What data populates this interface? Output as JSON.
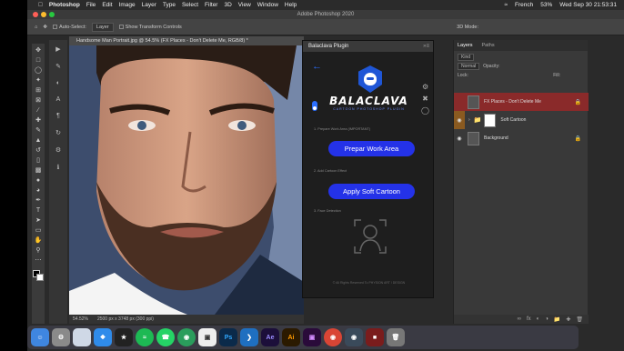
{
  "menubar": {
    "app": "Photoshop",
    "items": [
      "File",
      "Edit",
      "Image",
      "Layer",
      "Type",
      "Select",
      "Filter",
      "3D",
      "View",
      "Window",
      "Help"
    ],
    "language": "French",
    "battery": "53%",
    "datetime": "Wed Sep 30  21:53:31"
  },
  "window": {
    "title": "Adobe Photoshop 2020"
  },
  "options": {
    "auto_select_label": "Auto-Select:",
    "auto_select_value": "Layer",
    "show_transform": "Show Transform Controls",
    "mode_3d": "3D Mode:"
  },
  "document": {
    "tab_title": "Handsome Man Portrait.jpg @ 54.5% (FX Places - Don't Delete Me, RGB/8) *",
    "zoom": "54.52%",
    "dimensions": "2500 px x 3748 px (300 ppi)"
  },
  "plugin": {
    "title": "Balaclava Plugin",
    "brand": "BALACLAVA",
    "tagline": "CARTOON PHOTOSHOP PLUGIN",
    "step1": "1. Prepare Work Area (IMPORTANT)",
    "step2": "2. Add Cartoon Effect",
    "step3": "3. Face Detection",
    "btn_prepare": "Prepar Work Area",
    "btn_apply": "Apply Soft Cartoon",
    "footer": "© All Rights Reserved To PHYSION ART / DESIGN"
  },
  "layers_panel": {
    "tabs": [
      "Layers",
      "Paths"
    ],
    "filter": "Kind",
    "blend_mode": "Normal",
    "opacity_label": "Opacity:",
    "lock_label": "Lock:",
    "fill_label": "Fill:",
    "layers": [
      {
        "name": "FX Places - Don't Delete Me",
        "locked": true
      },
      {
        "name": "Soft Cartoon",
        "locked": false
      },
      {
        "name": "Background",
        "locked": true
      }
    ]
  },
  "colors": {
    "accent_blue": "#2432e8",
    "plugin_bg": "#1e1e1e",
    "selected_layer": "#8a2a2a"
  },
  "dock": {
    "icons": [
      "finder-icon",
      "launchpad-icon",
      "preview-icon",
      "safari-icon",
      "final-cut-icon",
      "spotify-icon",
      "whatsapp-icon",
      "chrome-icon",
      "screenflow-icon",
      "photoshop-icon",
      "vscode-icon",
      "after-effects-icon",
      "illustrator-icon",
      "premiere-icon",
      "chrome-icon-2",
      "camera-icon",
      "misc-icon",
      "trash-icon"
    ]
  }
}
